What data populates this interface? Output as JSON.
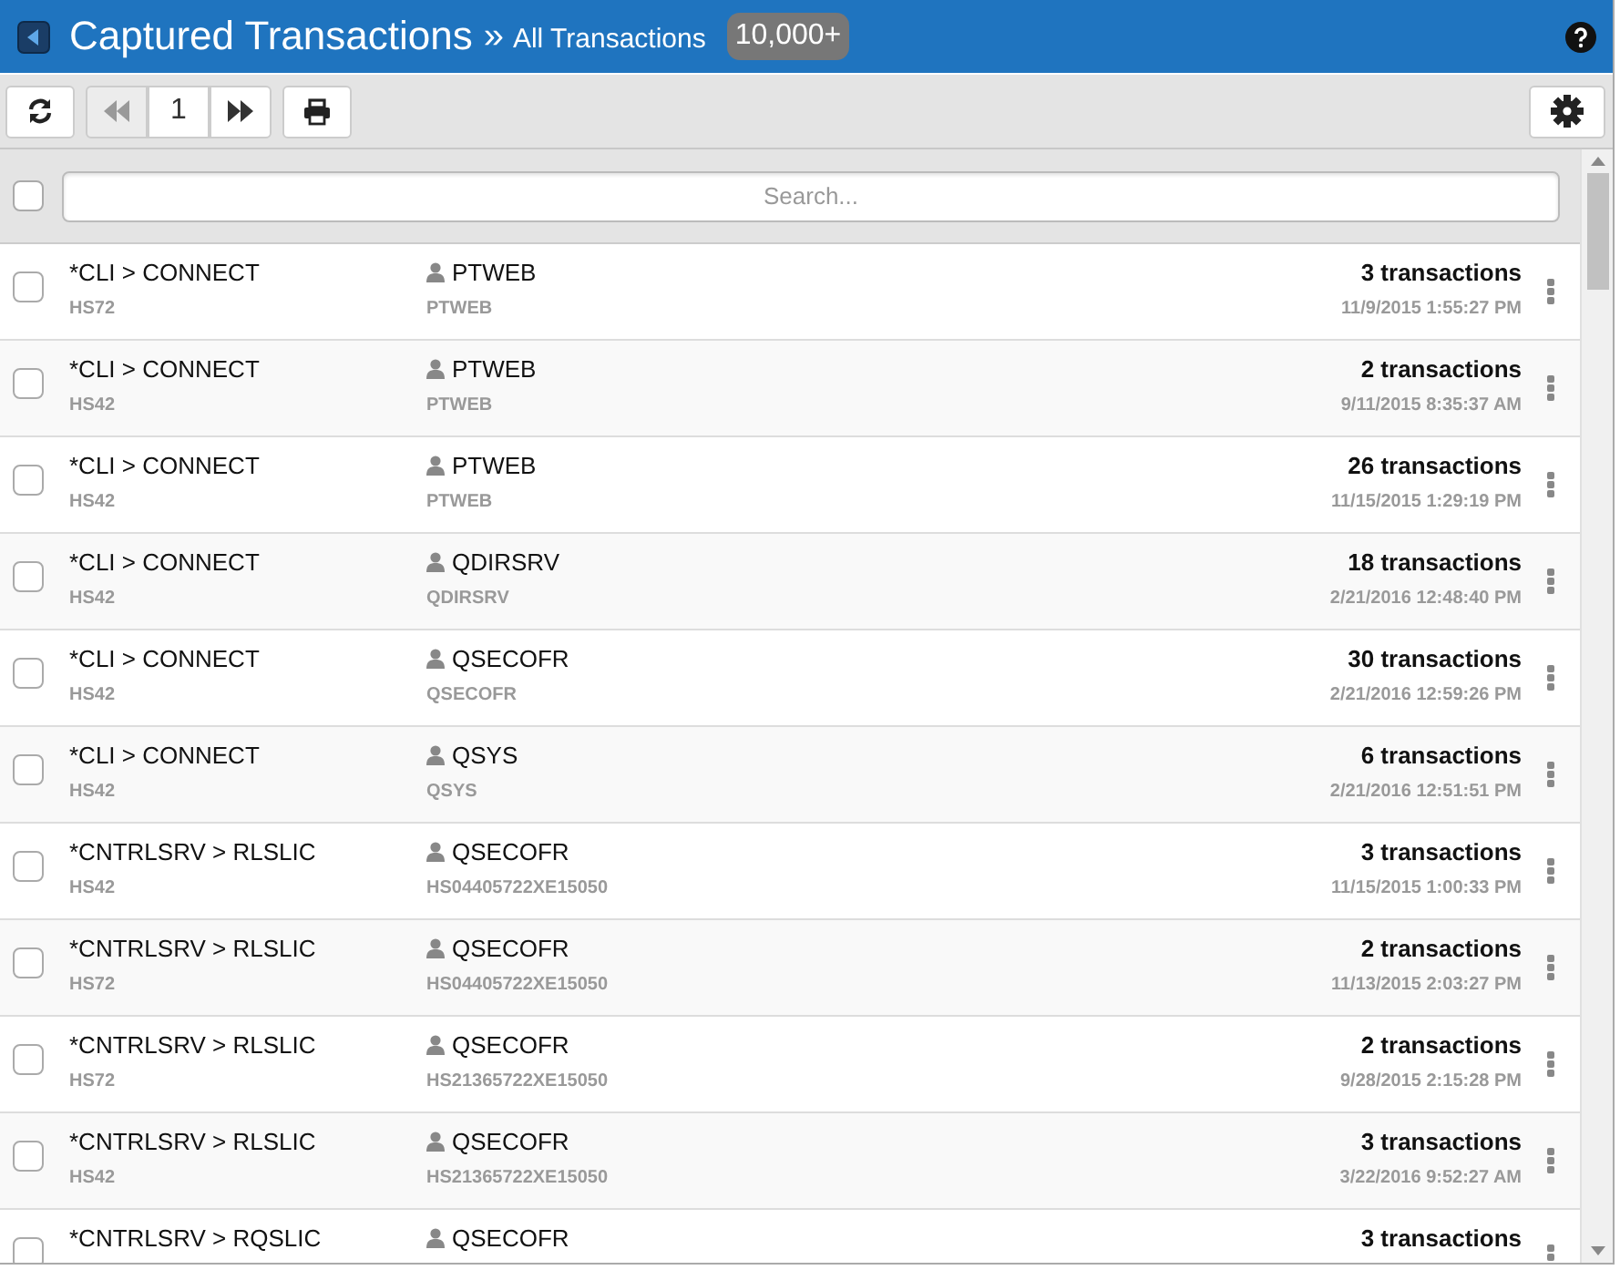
{
  "header": {
    "title": "Captured Transactions",
    "separator": "»",
    "subtitle": "All Transactions",
    "badge": "10,000+"
  },
  "toolbar": {
    "page": "1",
    "first_disabled": true,
    "next_disabled": false
  },
  "search": {
    "placeholder": "Search...",
    "select_all_checked": false
  },
  "rows": [
    {
      "action": "*CLI > CONNECT",
      "system": "HS72",
      "user": "PTWEB",
      "user_detail": "PTWEB",
      "count": "3 transactions",
      "time": "11/9/2015 1:55:27 PM",
      "checked": false
    },
    {
      "action": "*CLI > CONNECT",
      "system": "HS42",
      "user": "PTWEB",
      "user_detail": "PTWEB",
      "count": "2 transactions",
      "time": "9/11/2015 8:35:37 AM",
      "checked": false
    },
    {
      "action": "*CLI > CONNECT",
      "system": "HS42",
      "user": "PTWEB",
      "user_detail": "PTWEB",
      "count": "26 transactions",
      "time": "11/15/2015 1:29:19 PM",
      "checked": false
    },
    {
      "action": "*CLI > CONNECT",
      "system": "HS42",
      "user": "QDIRSRV",
      "user_detail": "QDIRSRV",
      "count": "18 transactions",
      "time": "2/21/2016 12:48:40 PM",
      "checked": false
    },
    {
      "action": "*CLI > CONNECT",
      "system": "HS42",
      "user": "QSECOFR",
      "user_detail": "QSECOFR",
      "count": "30 transactions",
      "time": "2/21/2016 12:59:26 PM",
      "checked": false
    },
    {
      "action": "*CLI > CONNECT",
      "system": "HS42",
      "user": "QSYS",
      "user_detail": "QSYS",
      "count": "6 transactions",
      "time": "2/21/2016 12:51:51 PM",
      "checked": false
    },
    {
      "action": "*CNTRLSRV > RLSLIC",
      "system": "HS42",
      "user": "QSECOFR",
      "user_detail": "HS04405722XE15050",
      "count": "3 transactions",
      "time": "11/15/2015 1:00:33 PM",
      "checked": false
    },
    {
      "action": "*CNTRLSRV > RLSLIC",
      "system": "HS72",
      "user": "QSECOFR",
      "user_detail": "HS04405722XE15050",
      "count": "2 transactions",
      "time": "11/13/2015 2:03:27 PM",
      "checked": false
    },
    {
      "action": "*CNTRLSRV > RLSLIC",
      "system": "HS72",
      "user": "QSECOFR",
      "user_detail": "HS21365722XE15050",
      "count": "2 transactions",
      "time": "9/28/2015 2:15:28 PM",
      "checked": false
    },
    {
      "action": "*CNTRLSRV > RLSLIC",
      "system": "HS42",
      "user": "QSECOFR",
      "user_detail": "HS21365722XE15050",
      "count": "3 transactions",
      "time": "3/22/2016 9:52:27 AM",
      "checked": false
    },
    {
      "action": "*CNTRLSRV > RQSLIC",
      "user": "QSECOFR",
      "count": "3 transactions",
      "checked": false
    }
  ]
}
